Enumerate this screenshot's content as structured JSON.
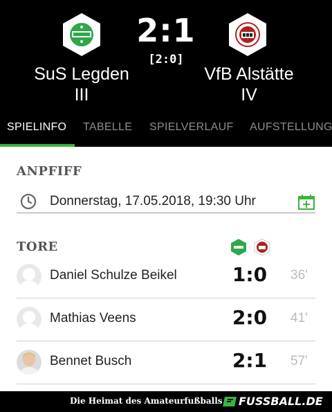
{
  "match": {
    "home_team": "SuS Legden\nIII",
    "away_team": "VfB Alstätte\nIV",
    "score": "2:1",
    "halftime": "[2:0]"
  },
  "tabs": [
    {
      "label": "SPIELINFO"
    },
    {
      "label": "TABELLE"
    },
    {
      "label": "SPIELVERLAUF"
    },
    {
      "label": "AUFSTELLUNG"
    }
  ],
  "kickoff": {
    "title": "ANPFIFF",
    "datetime": "Donnerstag, 17.05.2018, 19:30 Uhr"
  },
  "goals": {
    "title": "TORE",
    "items": [
      {
        "player": "Daniel Schulze Beikel",
        "score": "1:0",
        "minute": "36'",
        "avatar": "placeholder"
      },
      {
        "player": "Mathias Veens",
        "score": "2:0",
        "minute": "41'",
        "avatar": "placeholder"
      },
      {
        "player": "Bennet Busch",
        "score": "2:1",
        "minute": "57'",
        "avatar": "photo"
      }
    ]
  },
  "footer": {
    "slogan": "Die Heimat des Amateurfußballs",
    "brand": "FUSSBALL.DE"
  },
  "colors": {
    "accent": "#3cb43c",
    "header_bg": "#000000",
    "home_green": "#2ea84a",
    "away_red": "#b02020"
  },
  "icons": {
    "kickoff": "clock-icon",
    "calendar": "calendar-add-icon"
  }
}
